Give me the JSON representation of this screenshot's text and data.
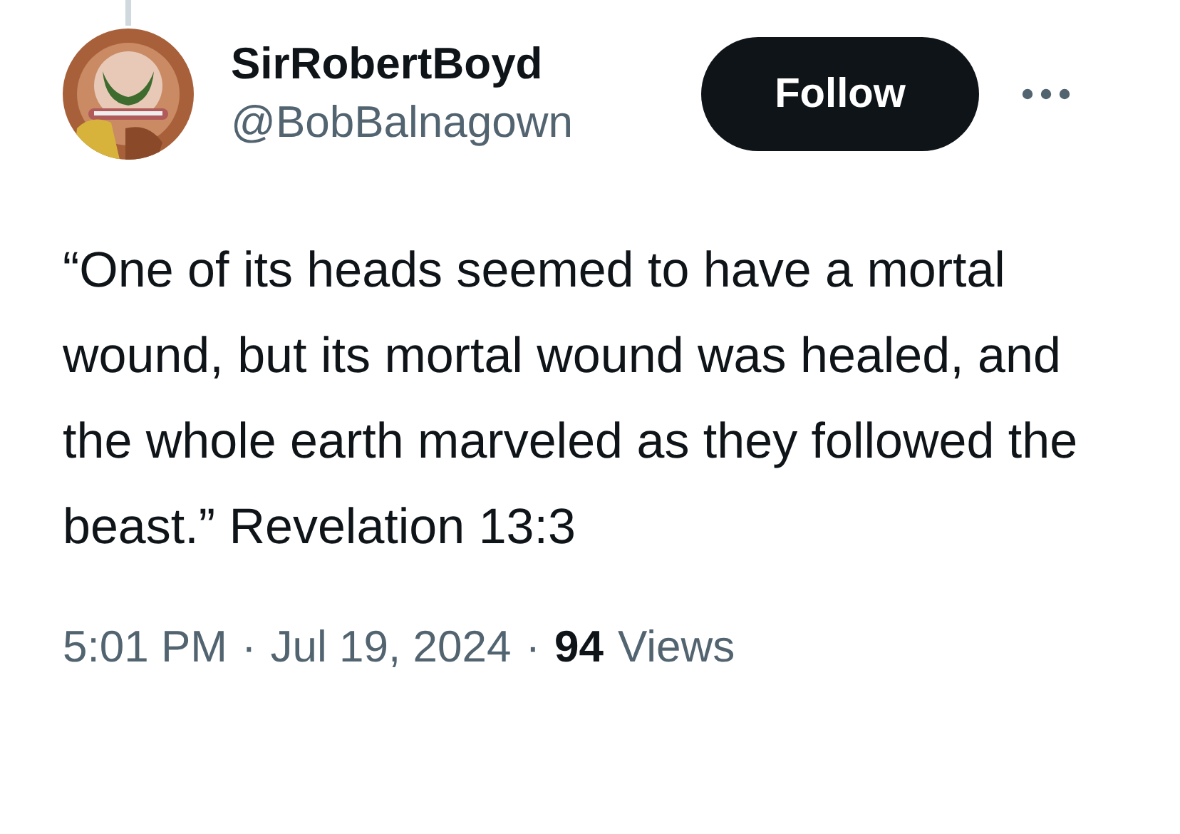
{
  "author": {
    "name": "SirRobertBoyd",
    "handle": "@BobBalnagown"
  },
  "follow_button": {
    "label": "Follow"
  },
  "text": "“One of its heads seemed to have a mortal wound, but its mortal wound was healed, and the whole earth marveled as they followed the beast.” Revelation 13:3",
  "meta": [
    {
      "kind": "time",
      "text": "5:01 PM"
    },
    {
      "kind": "sep",
      "text": "·"
    },
    {
      "kind": "date",
      "text": "Jul 19, 2024"
    },
    {
      "kind": "sep",
      "text": "·"
    },
    {
      "kind": "count",
      "text": "94"
    },
    {
      "kind": "label",
      "text": "Views"
    }
  ]
}
